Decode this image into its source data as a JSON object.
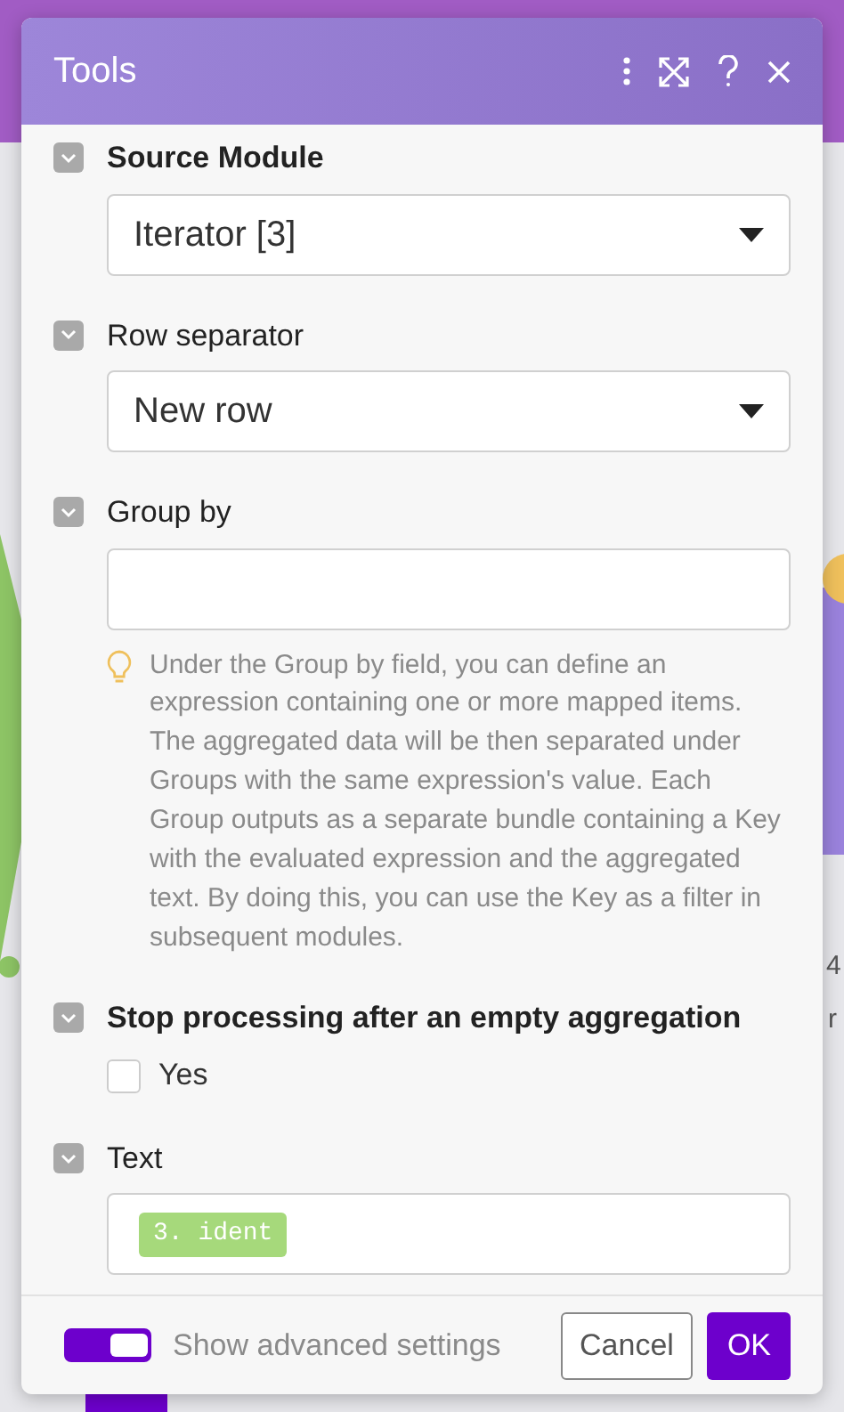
{
  "window": {
    "title": "Tools"
  },
  "sections": [
    {
      "kind": "select",
      "label": "Source Module",
      "required": true,
      "expanded": true,
      "value": "Iterator [3]"
    },
    {
      "kind": "select",
      "label": "Row separator",
      "required": false,
      "expanded": true,
      "value": "New row"
    },
    {
      "kind": "text",
      "label": "Group by",
      "required": false,
      "expanded": true,
      "hint": "Under the Group by field, you can define an expression containing one or more mapped items. The aggregated data will be then separated under Groups with the same expression's value. Each Group outputs as a separate bundle containing a Key with the evaluated expression and the aggregated text. By doing this, you can use the Key as a filter in subsequent modules."
    },
    {
      "kind": "checkbox",
      "label": "Stop processing after an empty aggregation",
      "required": true,
      "expanded": true,
      "option": "Yes",
      "checked": false
    },
    {
      "kind": "tags",
      "label": "Text",
      "required": false,
      "expanded": true,
      "tags": [
        "3. ident"
      ]
    }
  ],
  "footer": {
    "advanced_toggle": {
      "label": "Show advanced settings",
      "on": true
    },
    "buttons": [
      {
        "label": "Cancel",
        "primary": false
      },
      {
        "label": "OK",
        "primary": true
      }
    ]
  },
  "background_fragments": [
    "4",
    "r"
  ]
}
